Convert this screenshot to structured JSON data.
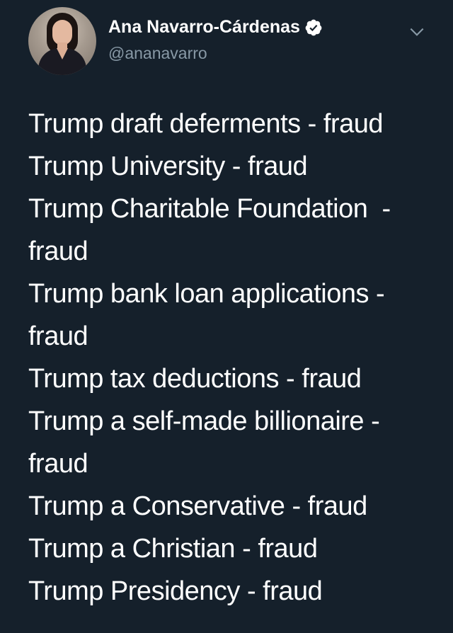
{
  "author": {
    "display_name": "Ana Navarro-Cárdenas",
    "handle": "@ananavarro",
    "verified": true,
    "avatar_icon": "profile-photo"
  },
  "icons": {
    "verified": "verified-badge-icon",
    "menu": "chevron-down-icon"
  },
  "colors": {
    "background": "#15202b",
    "text": "#ffffff",
    "secondary_text": "#8899a6"
  },
  "tweet": {
    "lines": [
      "Trump draft deferments - fraud",
      "Trump University - fraud",
      "Trump Charitable Foundation  -",
      "fraud",
      "Trump bank loan applications -",
      "fraud",
      "Trump tax deductions - fraud",
      "Trump a self-made billionaire -",
      "fraud",
      "Trump a Conservative - fraud",
      "Trump a Christian - fraud",
      "Trump Presidency - fraud"
    ]
  }
}
